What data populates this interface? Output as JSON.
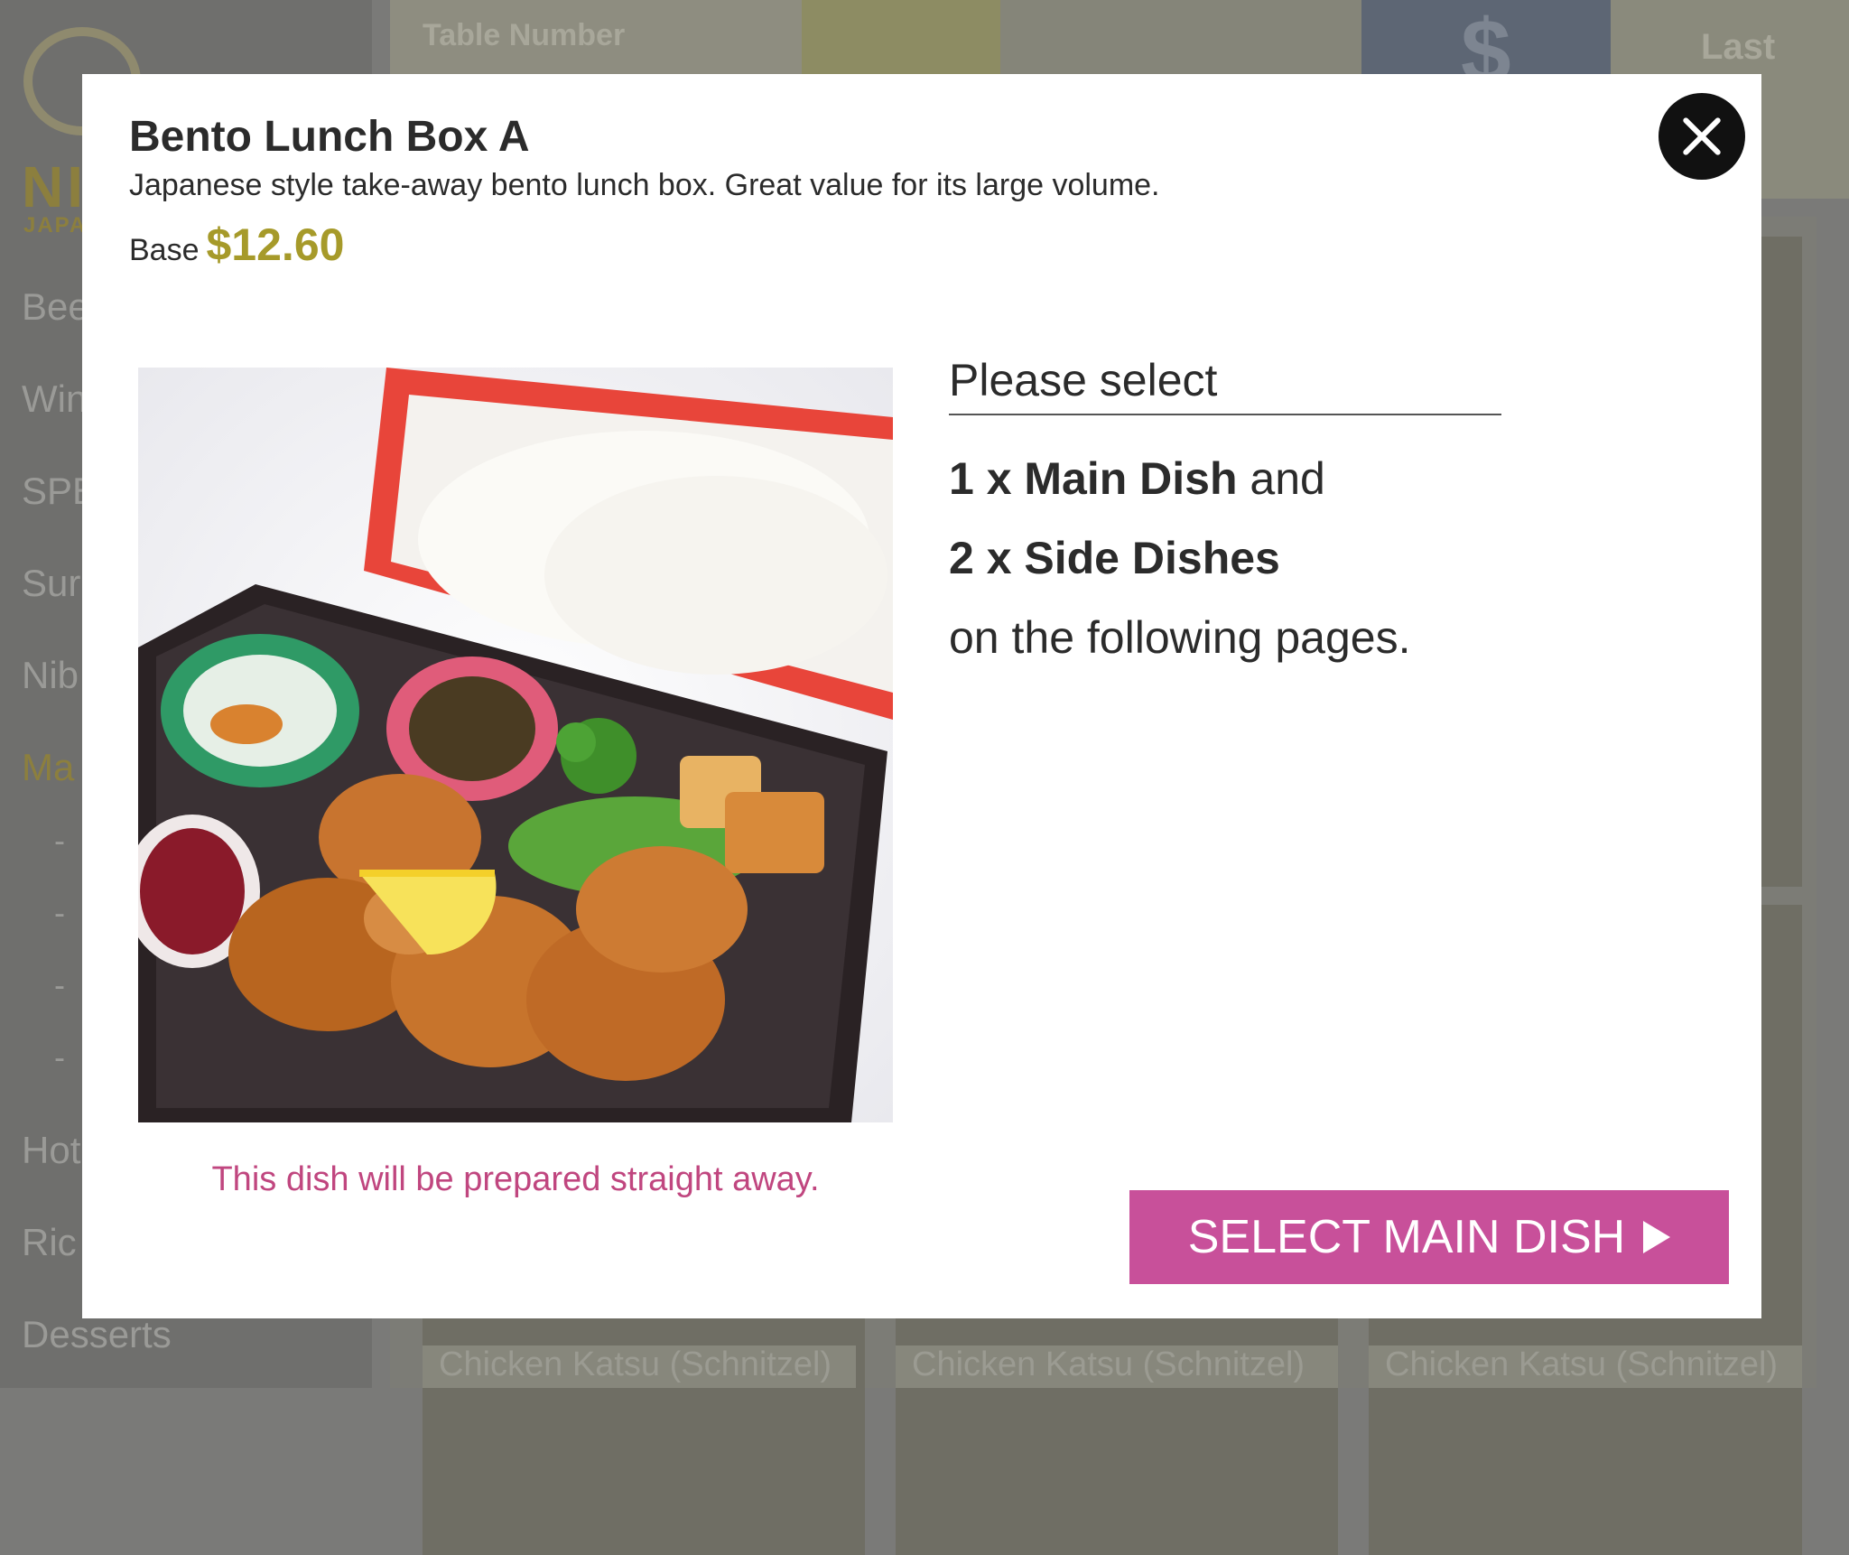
{
  "background": {
    "brand": {
      "logo_text": "NI",
      "logo_sub": "JAPA"
    },
    "sidebar": {
      "items": [
        {
          "label": "Bee"
        },
        {
          "label": "Win"
        },
        {
          "label": "SPE"
        },
        {
          "label": "Sur"
        },
        {
          "label": "Nib"
        },
        {
          "label": "Ma"
        },
        {
          "label": "Hot"
        },
        {
          "label": "Ric"
        },
        {
          "label": "Desserts"
        }
      ],
      "subitems": [
        "-",
        "-",
        "-",
        "-"
      ]
    },
    "topbar": {
      "table_label": "Table Number",
      "currency_symbol": "$",
      "last_label": "Last"
    },
    "captions": [
      "Chicken Katsu (Schnitzel)",
      "Chicken Katsu (Schnitzel)",
      "Chicken Katsu (Schnitzel)"
    ]
  },
  "modal": {
    "title": "Bento Lunch Box A",
    "description": "Japanese style take-away bento lunch box. Great value for its large volume.",
    "base_label": "Base",
    "price": "$12.60",
    "prep_note": "This dish will be prepared straight away.",
    "instructions": {
      "heading": "Please select",
      "line1_bold": "1 x Main Dish",
      "line1_rest": " and",
      "line2_bold": "2 x Side Dishes",
      "line3": "on the following pages."
    },
    "select_button": "SELECT MAIN DISH",
    "close_icon": "close-icon",
    "button_icon": "play-triangle-icon"
  },
  "colors": {
    "price": "#a69a2a",
    "accent": "#c8509a",
    "note": "#c0467f"
  }
}
